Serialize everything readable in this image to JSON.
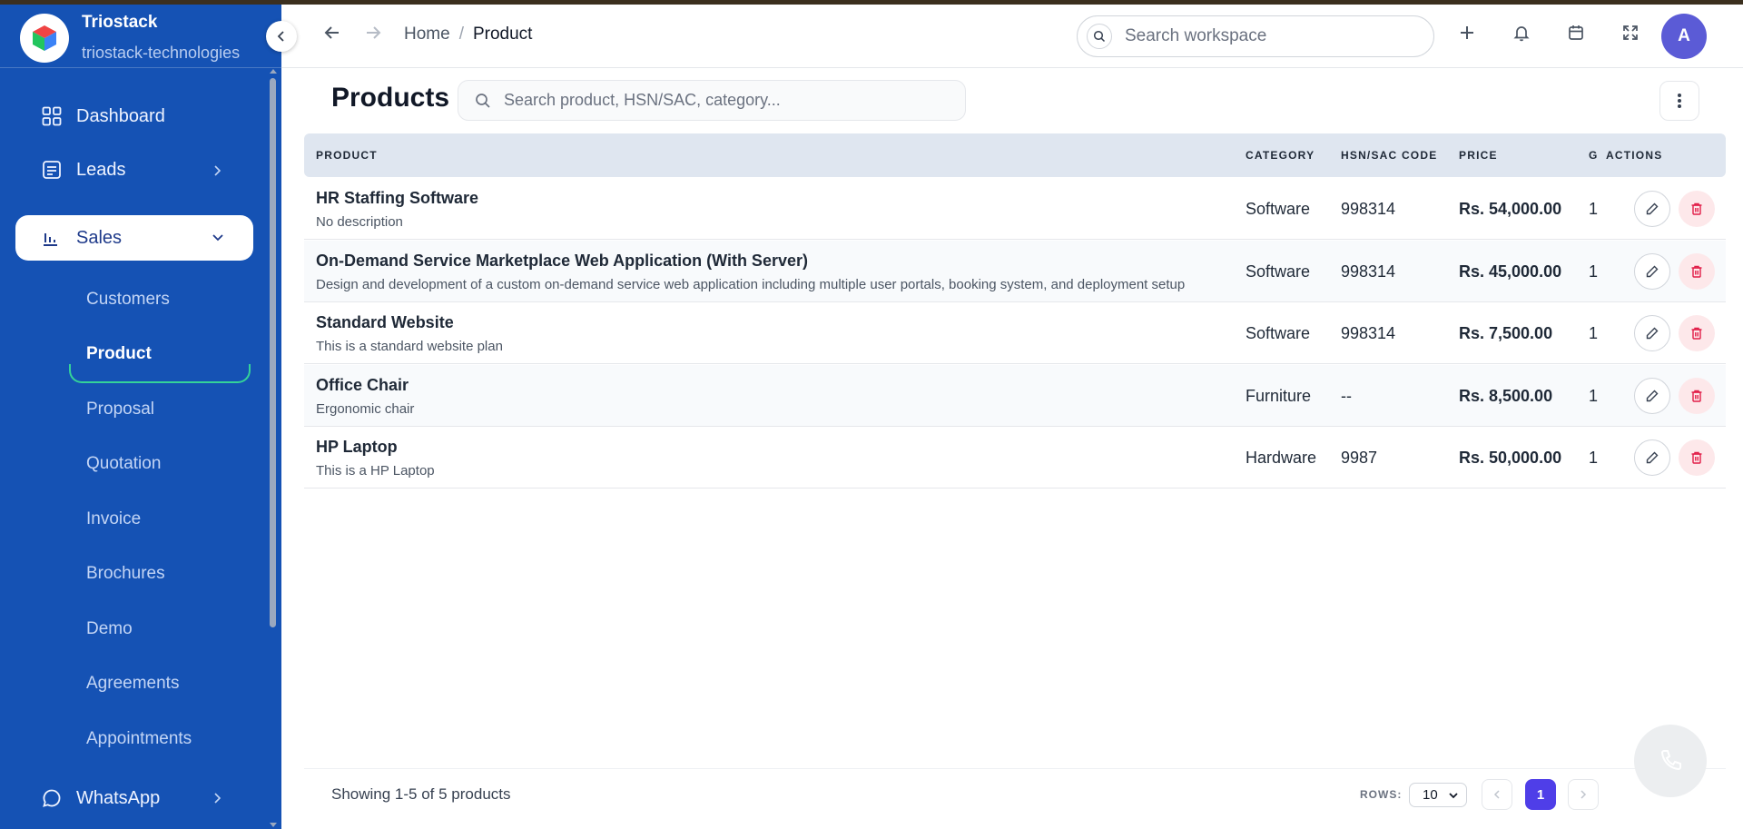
{
  "brand": {
    "name": "Triostack",
    "workspace": "triostack-technologies"
  },
  "sidebar": {
    "items": [
      {
        "label": "Dashboard",
        "icon": "grid-icon"
      },
      {
        "label": "Leads",
        "icon": "list-icon"
      },
      {
        "label": "Sales",
        "icon": "bar-chart-icon"
      },
      {
        "label": "WhatsApp",
        "icon": "chat-icon"
      }
    ],
    "sales_sub": [
      "Customers",
      "Product",
      "Proposal",
      "Quotation",
      "Invoice",
      "Brochures",
      "Demo",
      "Agreements",
      "Appointments"
    ],
    "active_sub": "Product"
  },
  "header": {
    "breadcrumb_home": "Home",
    "breadcrumb_sep": "/",
    "breadcrumb_current": "Product",
    "search_placeholder": "Search workspace",
    "avatar_initial": "A"
  },
  "page": {
    "title": "Products",
    "search_placeholder": "Search product, HSN/SAC, category..."
  },
  "table": {
    "headers": {
      "product": "PRODUCT",
      "category": "CATEGORY",
      "hsn": "HSN/SAC CODE",
      "price": "PRICE",
      "gst": "G",
      "actions": "ACTIONS"
    },
    "rows": [
      {
        "name": "HR Staffing Software",
        "desc": "No description",
        "category": "Software",
        "hsn": "998314",
        "price": "Rs. 54,000.00",
        "gst": "1"
      },
      {
        "name": "On-Demand Service Marketplace Web Application (With Server)",
        "desc": "Design and development of a custom on-demand service web application including multiple user portals, booking system, and deployment setup",
        "category": "Software",
        "hsn": "998314",
        "price": "Rs. 45,000.00",
        "gst": "1"
      },
      {
        "name": "Standard Website",
        "desc": "This is a standard website plan",
        "category": "Software",
        "hsn": "998314",
        "price": "Rs. 7,500.00",
        "gst": "1"
      },
      {
        "name": "Office Chair",
        "desc": "Ergonomic chair",
        "category": "Furniture",
        "hsn": "--",
        "price": "Rs. 8,500.00",
        "gst": "1"
      },
      {
        "name": "HP Laptop",
        "desc": "This is a HP Laptop",
        "category": "Hardware",
        "hsn": "9987",
        "price": "Rs. 50,000.00",
        "gst": "1"
      }
    ]
  },
  "footer": {
    "showing": "Showing 1-5 of 5 products",
    "rows_label": "ROWS:",
    "rows_value": "10",
    "current_page": "1"
  },
  "colors": {
    "sidebar": "#1552b4",
    "accent": "#4f3ee8",
    "avatar": "#5b5bd6",
    "delete": "#e11d48",
    "active_underline": "#34d399"
  }
}
